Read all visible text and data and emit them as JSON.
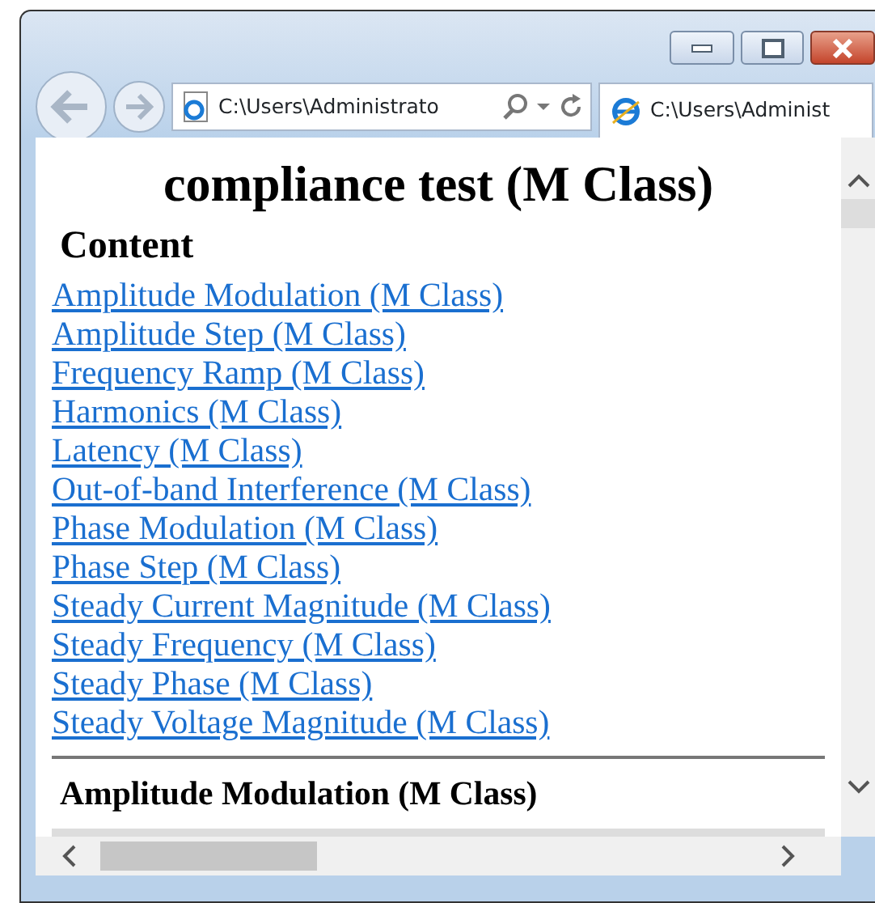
{
  "browser": {
    "address": "C:\\Users\\Administrato",
    "tab_title": "C:\\Users\\Administ"
  },
  "page": {
    "title": "compliance test (M Class)",
    "contents_heading": "Content",
    "links": [
      "Amplitude Modulation (M Class)",
      "Amplitude Step (M Class)",
      "Frequency Ramp (M Class)",
      "Harmonics (M Class)",
      "Latency (M Class)",
      "Out-of-band Interference (M Class)",
      "Phase Modulation (M Class)",
      "Phase Step (M Class)",
      "Steady Current Magnitude (M Class)",
      "Steady Frequency (M Class)",
      "Steady Phase (M Class)",
      "Steady Voltage Magnitude (M Class)"
    ],
    "section_heading": "Amplitude Modulation (M Class)"
  }
}
